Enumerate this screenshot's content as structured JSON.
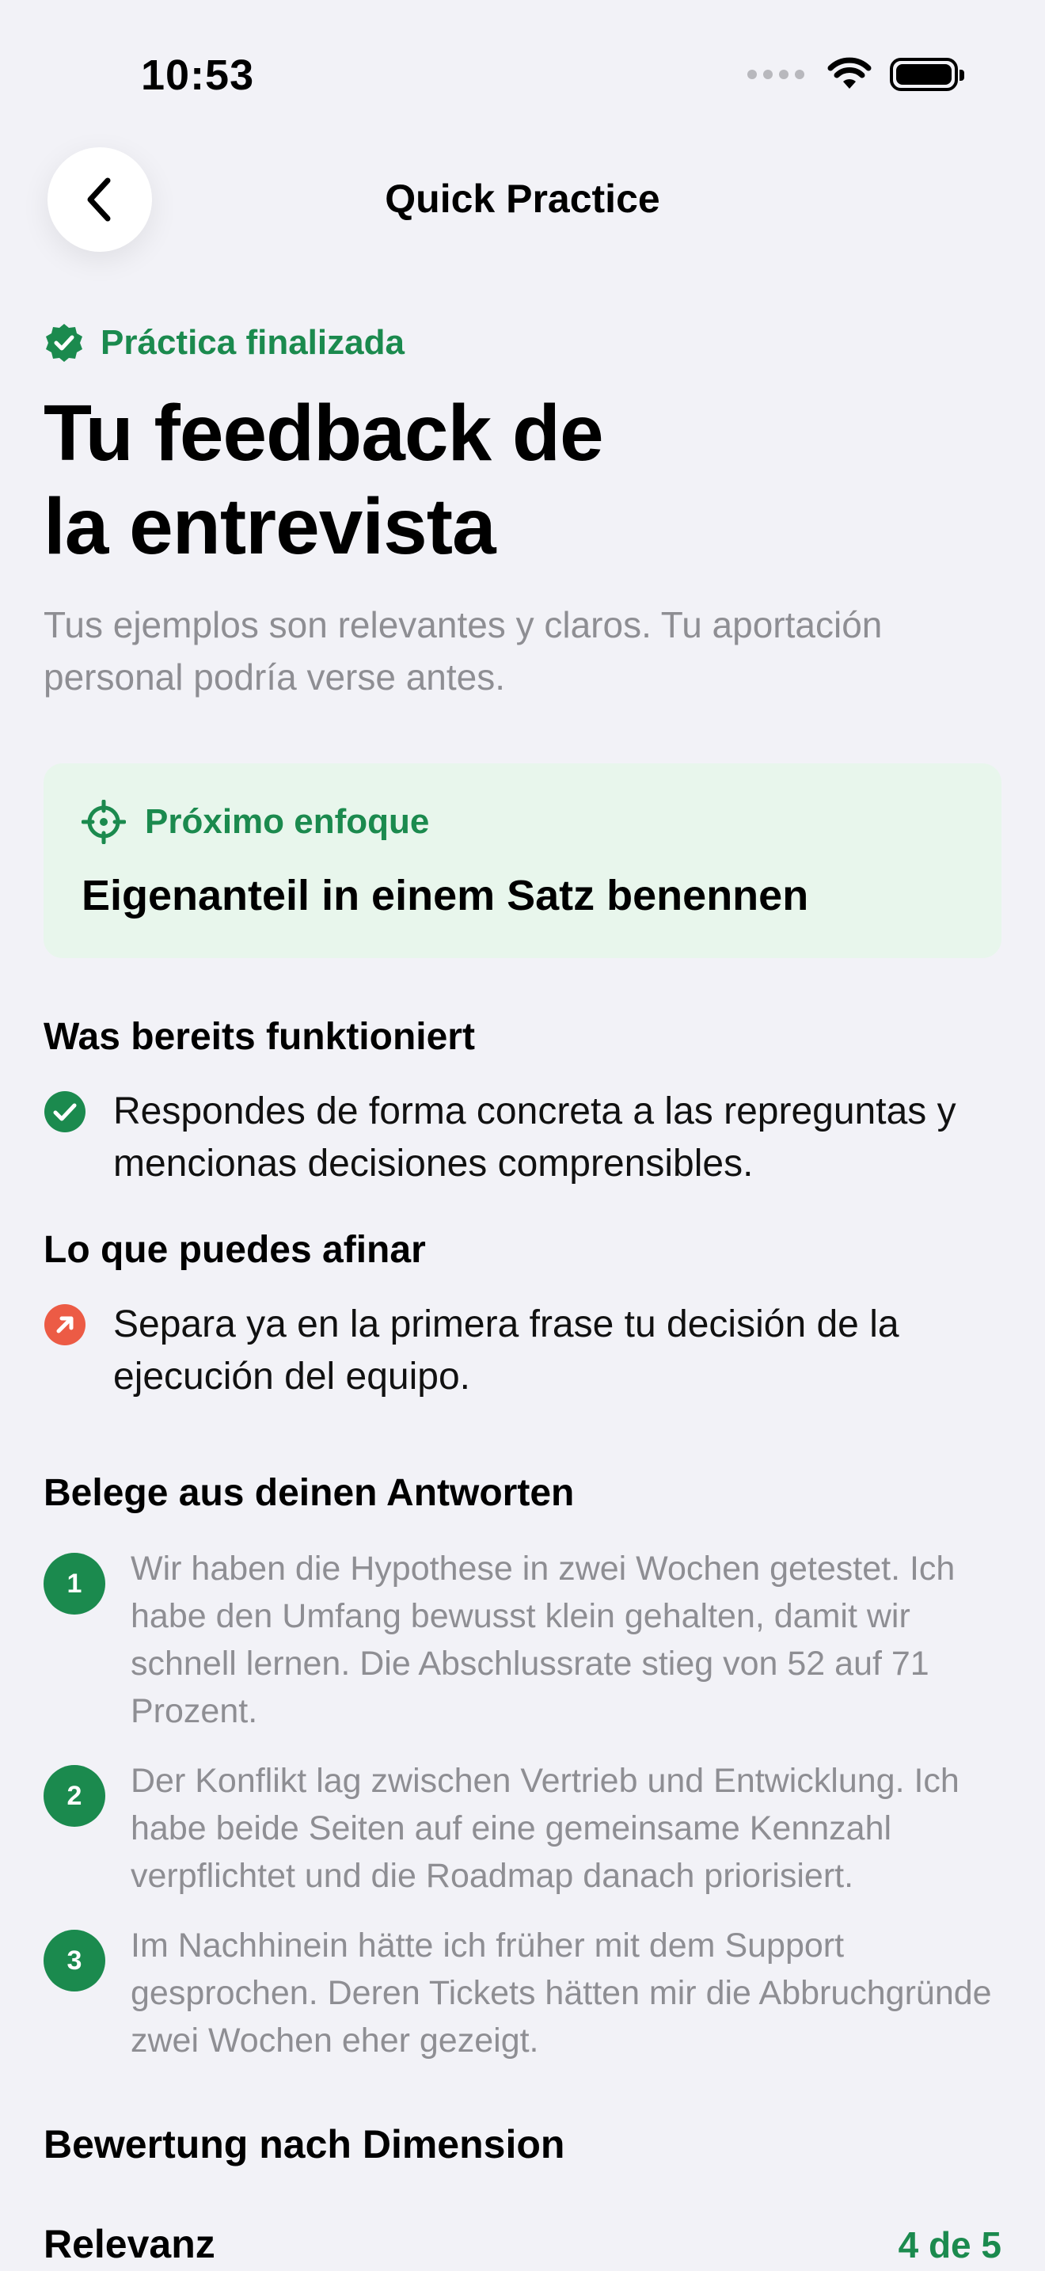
{
  "status": {
    "time": "10:53"
  },
  "nav": {
    "title": "Quick Practice"
  },
  "badge": {
    "label": "Práctica finalizada"
  },
  "page": {
    "title_line1": "Tu feedback de",
    "title_line2": "la entrevista",
    "summary": "Tus ejemplos son relevantes y claros. Tu aportación personal podría verse antes."
  },
  "focus": {
    "label": "Próximo enfoque",
    "value": "Eigenanteil in einem Satz benennen"
  },
  "strengths": {
    "title": "Was bereits funktioniert",
    "items": [
      "Respondes de forma concreta a las repreguntas y mencionas decisiones comprensibles."
    ]
  },
  "improvements": {
    "title": "Lo que puedes afinar",
    "items": [
      "Separa ya en la primera frase tu decisión de la ejecución del equipo."
    ]
  },
  "evidence": {
    "title": "Belege aus deinen Antworten",
    "items": [
      {
        "num": "1",
        "text": "Wir haben die Hypothese in zwei Wochen getestet. Ich habe den Umfang bewusst klein gehalten, damit wir schnell lernen. Die Abschlussrate stieg von 52 auf 71 Prozent."
      },
      {
        "num": "2",
        "text": "Der Konflikt lag zwischen Vertrieb und Entwicklung. Ich habe beide Seiten auf eine gemeinsame Kennzahl verpflichtet und die Roadmap danach priorisiert."
      },
      {
        "num": "3",
        "text": "Im Nachhinein hätte ich früher mit dem Support gesprochen. Deren Tickets hätten mir die Abbruchgründe zwei Wochen eher gezeigt."
      }
    ]
  },
  "dimensions": {
    "title": "Bewertung nach Dimension",
    "items": [
      {
        "name": "Relevanz",
        "score": "4 de 5"
      }
    ]
  },
  "colors": {
    "accent": "#1b8a4e",
    "focus_bg": "#e8f6ec",
    "warning": "#ec5b45",
    "background": "#f2f2f7"
  }
}
